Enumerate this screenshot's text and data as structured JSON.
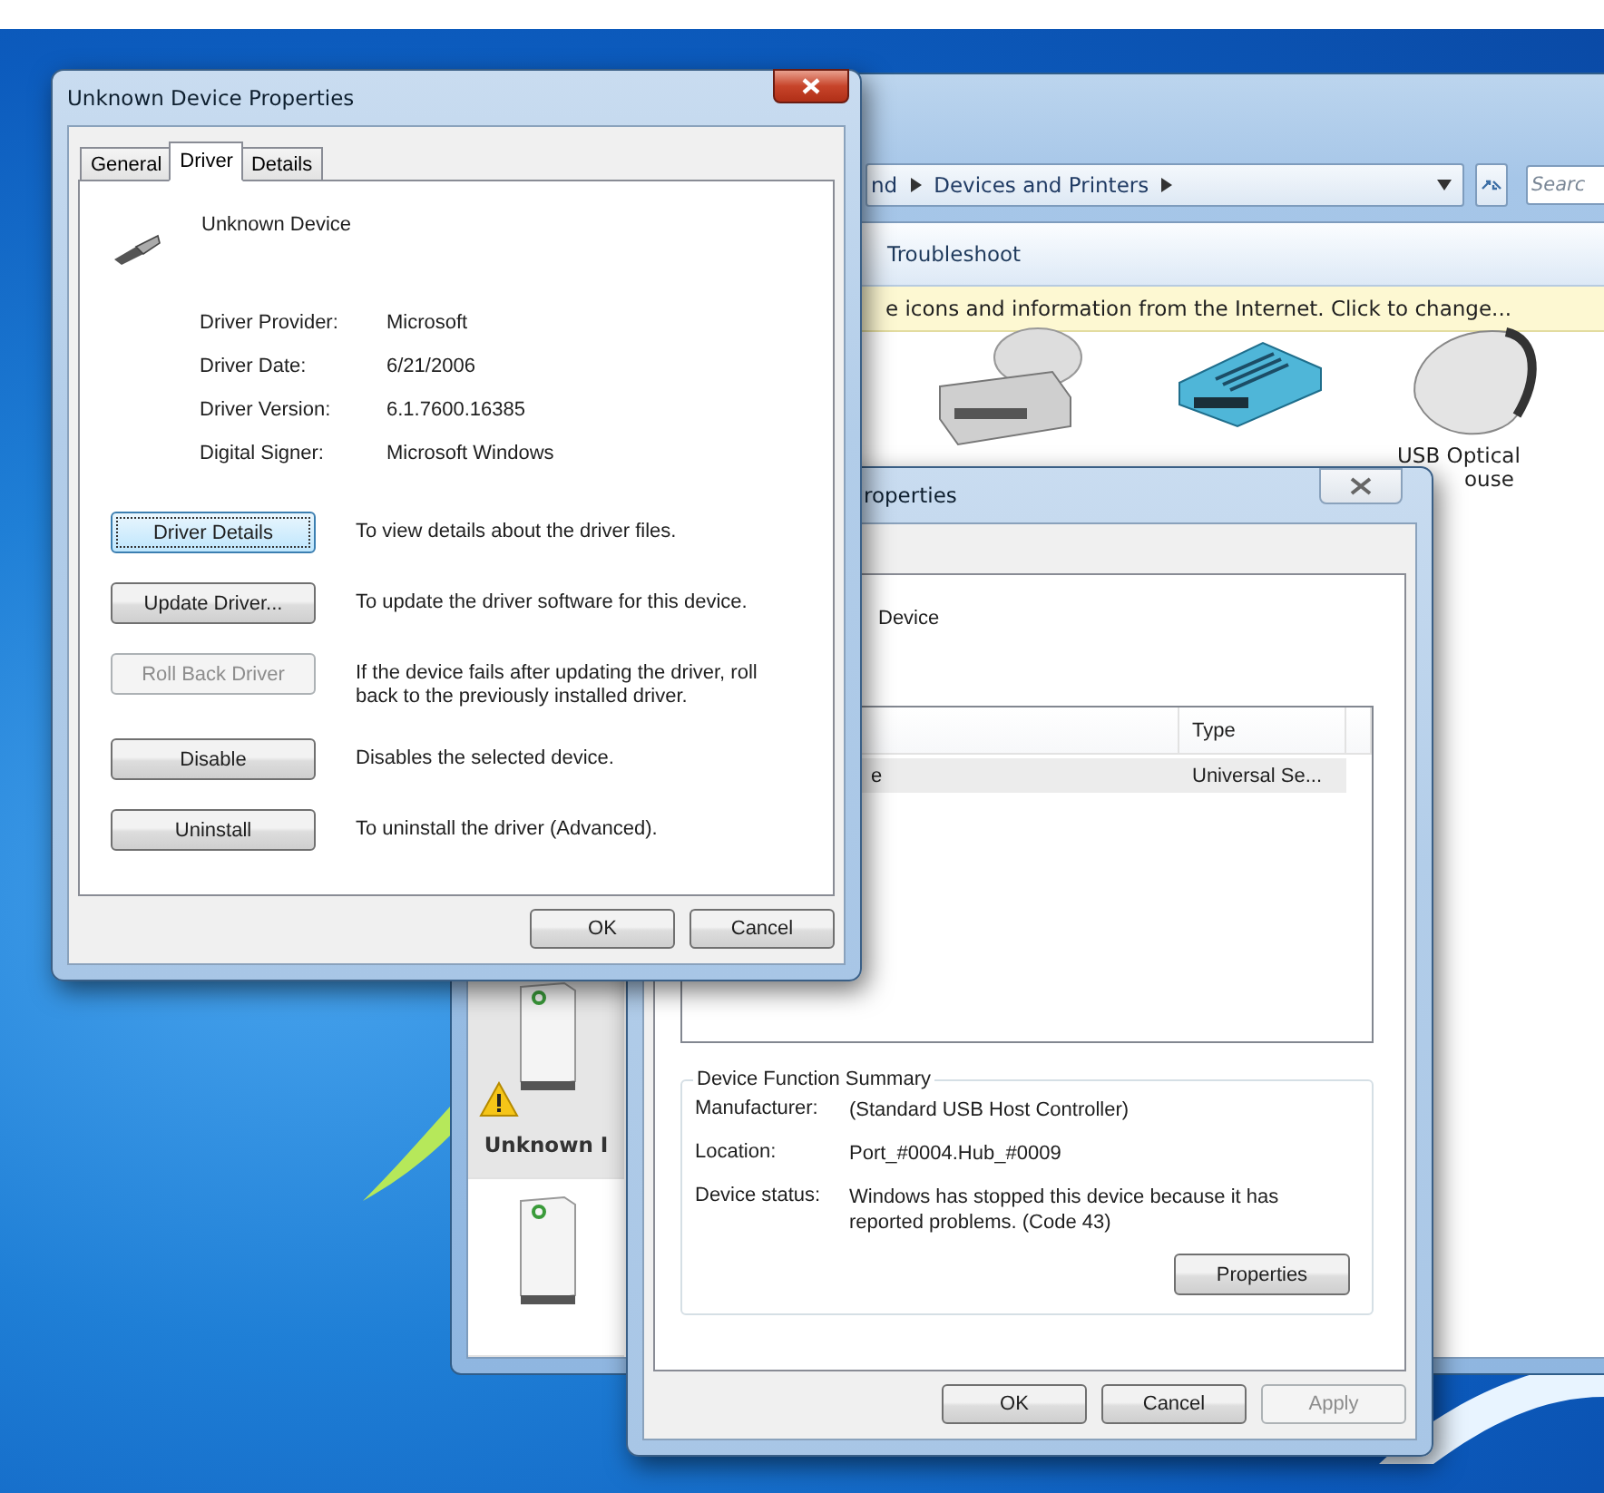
{
  "explorer": {
    "breadcrumb": [
      "nd",
      "Devices and Printers"
    ],
    "search": {
      "placeholder": "Searc"
    },
    "toolbar": [
      "Troubleshoot"
    ],
    "info_bar": "e icons and information from the Internet. Click to change...",
    "devices": [
      {
        "kind": "drive"
      },
      {
        "kind": "modem"
      },
      {
        "kind": "mouse",
        "lines": [
          "USB Optical",
          "ouse"
        ]
      }
    ],
    "lower_devices": [
      {
        "kind": "hub",
        "label": "Unknown I",
        "warning": true,
        "selected": true
      },
      {
        "kind": "hub",
        "warning": false,
        "selected": false
      }
    ]
  },
  "back_dialog": {
    "title": "roperties",
    "device_name": "Device",
    "list": {
      "columns": [
        "",
        "Type"
      ],
      "rows": [
        {
          "cells": [
            "e",
            "Universal Se..."
          ],
          "selected": true
        }
      ]
    },
    "summary": {
      "title": "Device Function Summary",
      "fields": [
        {
          "label": "Manufacturer:",
          "value": "(Standard USB Host Controller)"
        },
        {
          "label": "Location:",
          "value": "Port_#0004.Hub_#0009"
        },
        {
          "label": "Device status:",
          "value": "Windows has stopped this device because it has reported problems. (Code 43)"
        }
      ],
      "button": "Properties"
    },
    "buttons": [
      {
        "label": "OK",
        "disabled": false
      },
      {
        "label": "Cancel",
        "disabled": false
      },
      {
        "label": "Apply",
        "disabled": true
      }
    ]
  },
  "front_dialog": {
    "title": "Unknown Device Properties",
    "tabs": [
      {
        "label": "General",
        "selected": false
      },
      {
        "label": "Driver",
        "selected": true
      },
      {
        "label": "Details",
        "selected": false
      }
    ],
    "device_name": "Unknown Device",
    "info": [
      {
        "label": "Driver Provider:",
        "value": "Microsoft"
      },
      {
        "label": "Driver Date:",
        "value": "6/21/2006"
      },
      {
        "label": "Driver Version:",
        "value": "6.1.7600.16385"
      },
      {
        "label": "Digital Signer:",
        "value": "Microsoft Windows"
      }
    ],
    "actions": [
      {
        "label": "Driver Details",
        "description": "To view details about the driver files.",
        "disabled": false,
        "focused": true
      },
      {
        "label": "Update Driver...",
        "description": "To update the driver software for this device.",
        "disabled": false,
        "focused": false
      },
      {
        "label": "Roll Back Driver",
        "description": "If the device fails after updating the driver, roll back to the previously installed driver.",
        "disabled": true,
        "focused": false
      },
      {
        "label": "Disable",
        "description": "Disables the selected device.",
        "disabled": false,
        "focused": false
      },
      {
        "label": "Uninstall",
        "description": "To uninstall the driver (Advanced).",
        "disabled": false,
        "focused": false
      }
    ],
    "buttons": [
      {
        "label": "OK",
        "disabled": false
      },
      {
        "label": "Cancel",
        "disabled": false
      }
    ]
  }
}
